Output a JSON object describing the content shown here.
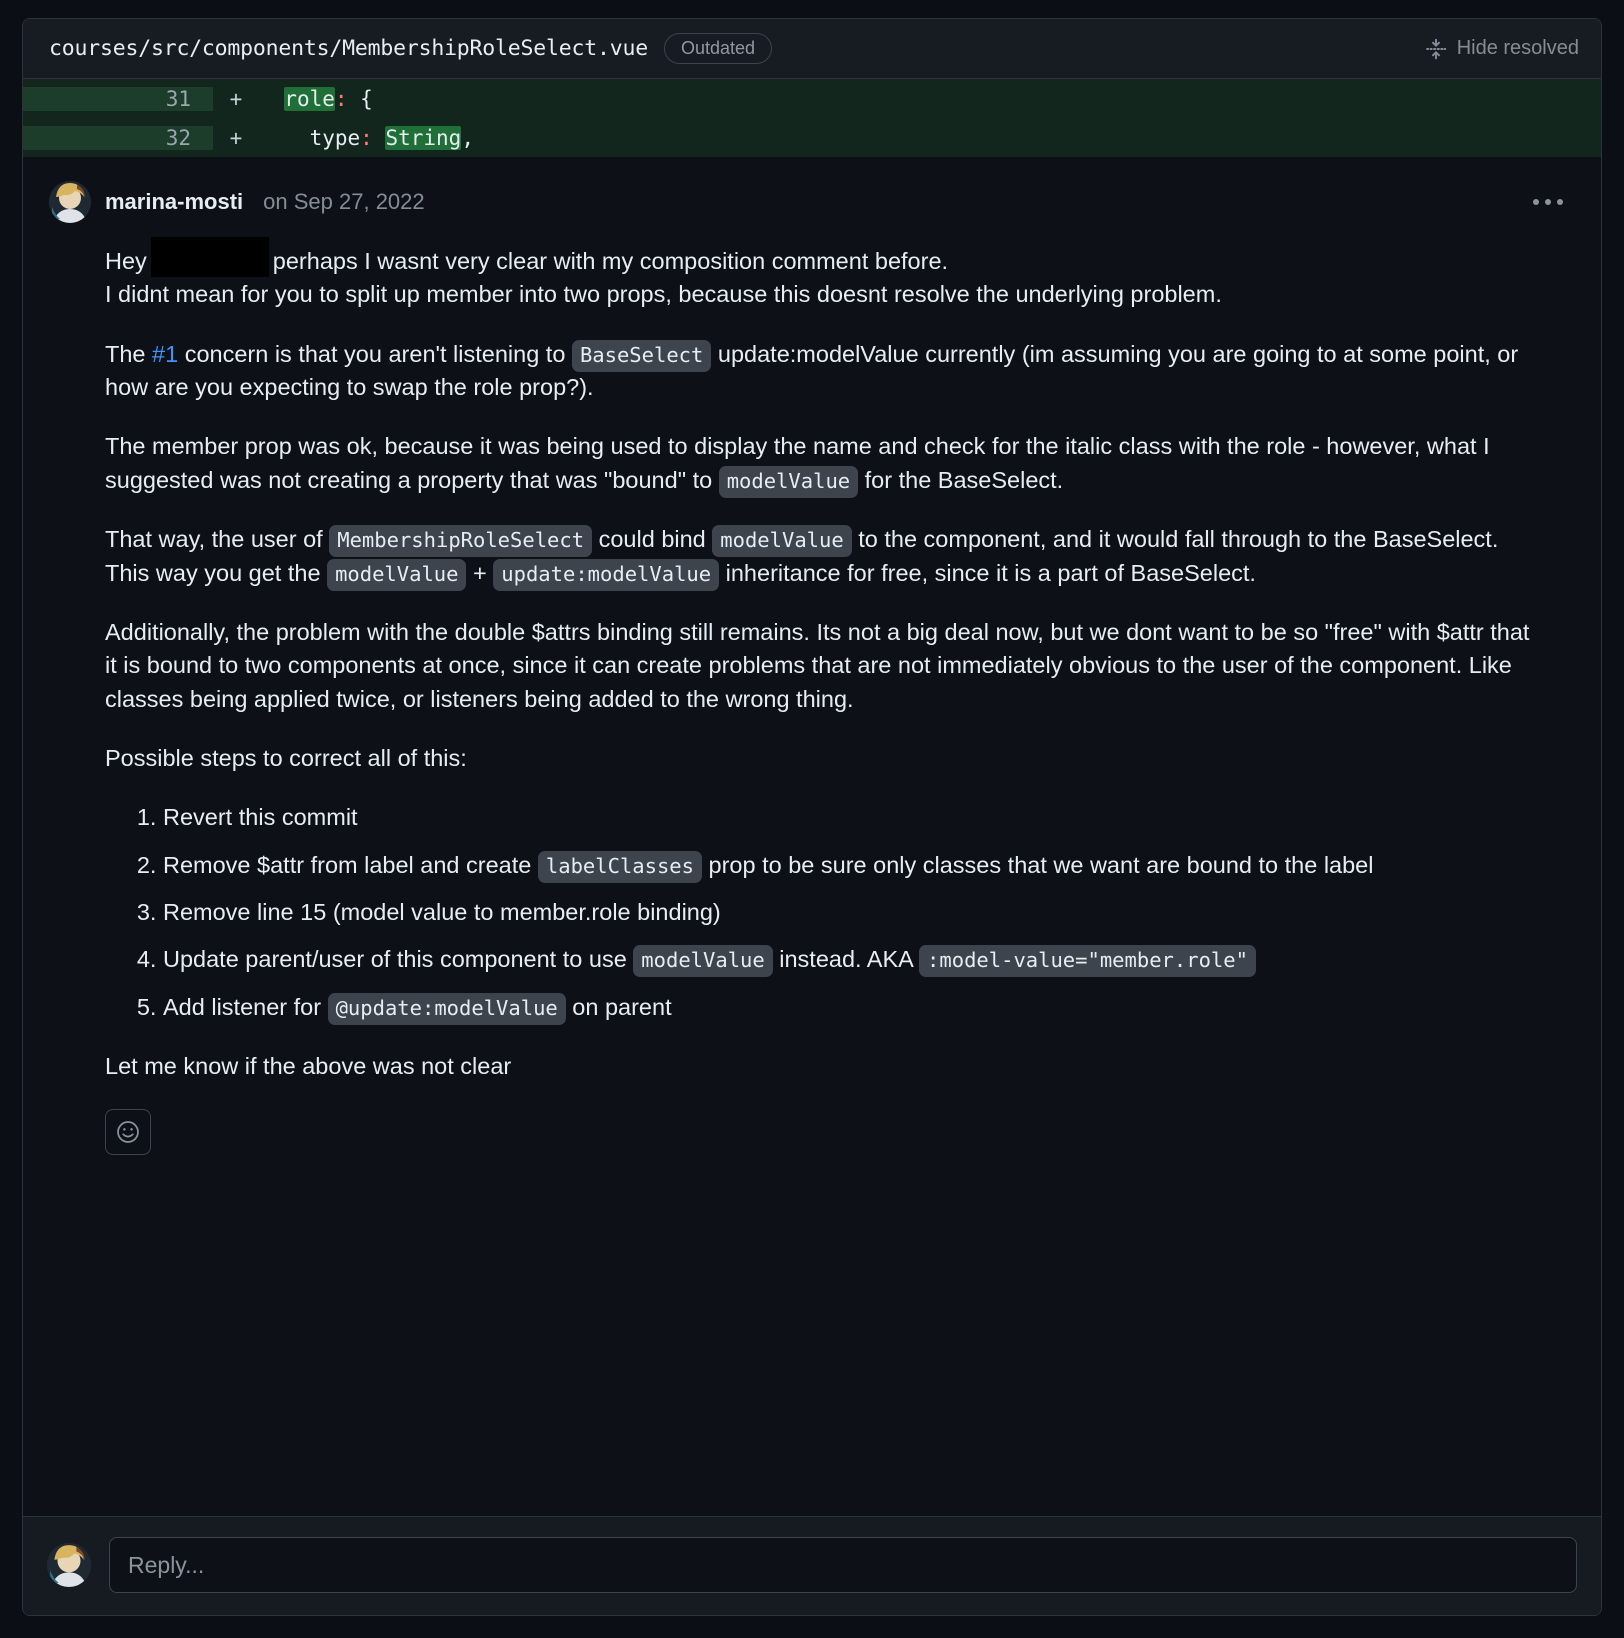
{
  "header": {
    "file_path": "courses/src/components/MembershipRoleSelect.vue",
    "outdated_badge": "Outdated",
    "hide_resolved_label": "Hide resolved",
    "fold_icon": "fold-icon"
  },
  "diff": {
    "rows": [
      {
        "line_number": "31",
        "sign": "+",
        "indent": "  ",
        "added_word": "role",
        "punct": ":",
        "rest": " {"
      },
      {
        "line_number": "32",
        "sign": "+",
        "indent": "    ",
        "pre": "type",
        "punct": ":",
        "added_word": "String",
        "rest": ","
      }
    ]
  },
  "comment": {
    "author": "marina-mosti",
    "timestamp": "on Sep 27, 2022",
    "menu_icon": "kebab-menu-icon",
    "avatar_icon": "user-avatar",
    "p1_a": "Hey",
    "p1_b": "perhaps I wasnt very clear with my composition comment before.",
    "p1_c": "I didnt mean for you to split up member into two props, because this doesnt resolve the underlying problem.",
    "p2_a": "The ",
    "p2_link": "#1",
    "p2_b": " concern is that you aren't listening to ",
    "p2_code": "BaseSelect",
    "p2_c": " update:modelValue currently (im assuming you are going to at some point, or how are you expecting to swap the role prop?).",
    "p3_a": "The member prop was ok, because it was being used to display the name and check for the italic class with the role - however, what I suggested was not creating a property that was \"bound\" to ",
    "p3_code": "modelValue",
    "p3_b": " for the BaseSelect.",
    "p4_a": "That way, the user of ",
    "p4_code1": "MembershipRoleSelect",
    "p4_b": " could bind ",
    "p4_code2": "modelValue",
    "p4_c": " to the component, and it would fall through to the BaseSelect. This way you get the ",
    "p4_code3": "modelValue",
    "p4_d": " + ",
    "p4_code4": "update:modelValue",
    "p4_e": " inheritance for free, since it is a part of BaseSelect.",
    "p5": "Additionally, the problem with the double $attrs binding still remains. Its not a big deal now, but we dont want to be so \"free\" with $attr that it is bound to two components at once, since it can create problems that are not immediately obvious to the user of the component. Like classes being applied twice, or listeners being added to the wrong thing.",
    "p6": "Possible steps to correct all of this:",
    "steps": [
      {
        "text_a": "Revert this commit",
        "code": "",
        "text_b": ""
      },
      {
        "text_a": "Remove $attr from label and create ",
        "code": "labelClasses",
        "text_b": " prop to be sure only classes that we want are bound to the label"
      },
      {
        "text_a": "Remove line 15 (model value to member.role binding)",
        "code": "",
        "text_b": ""
      },
      {
        "text_a": "Update parent/user of this component to use ",
        "code": "modelValue",
        "text_b": " instead. AKA ",
        "code2": ":model-value=\"member.role\""
      },
      {
        "text_a": "Add listener for ",
        "code": "@update:modelValue",
        "text_b": " on parent"
      }
    ],
    "p7": "Let me know if the above was not clear",
    "reaction_icon": "smiley-face-icon"
  },
  "reply": {
    "placeholder": "Reply...",
    "avatar_icon": "user-avatar"
  },
  "colors": {
    "background": "#0d1117",
    "header_background": "#171b22",
    "diff_add_background": "#12261e",
    "diff_add_word": "#1f6f36",
    "border": "#2d333b",
    "link": "#4493f8",
    "text": "#e6edf3",
    "muted_text": "#848d97",
    "code_chip_background": "#3d444d",
    "punct": "#ff7b72"
  }
}
